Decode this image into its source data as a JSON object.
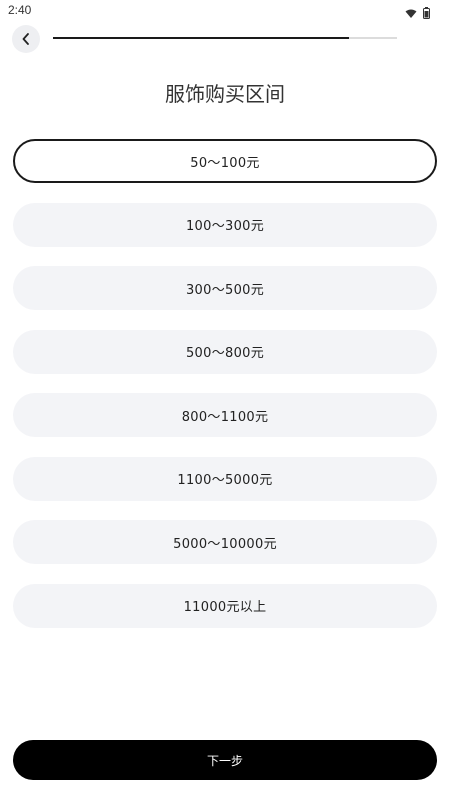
{
  "status_bar": {
    "time": "2:40"
  },
  "progress": {
    "fraction": 0.86
  },
  "page_title": "服饰购买区间",
  "options": [
    {
      "label": "50～100元",
      "selected": true
    },
    {
      "label": "100～300元",
      "selected": false
    },
    {
      "label": "300～500元",
      "selected": false
    },
    {
      "label": "500～800元",
      "selected": false
    },
    {
      "label": "800～1100元",
      "selected": false
    },
    {
      "label": "1100～5000元",
      "selected": false
    },
    {
      "label": "5000～10000元",
      "selected": false
    },
    {
      "label": "11000元以上",
      "selected": false
    }
  ],
  "next_button": {
    "label": "下一步"
  },
  "colors": {
    "accent": "#000000",
    "option_bg": "#f3f4f7",
    "selected_border": "#1a1a1a"
  },
  "icons": {
    "back": "chevron-left-icon",
    "wifi": "wifi-icon",
    "battery": "battery-icon"
  }
}
